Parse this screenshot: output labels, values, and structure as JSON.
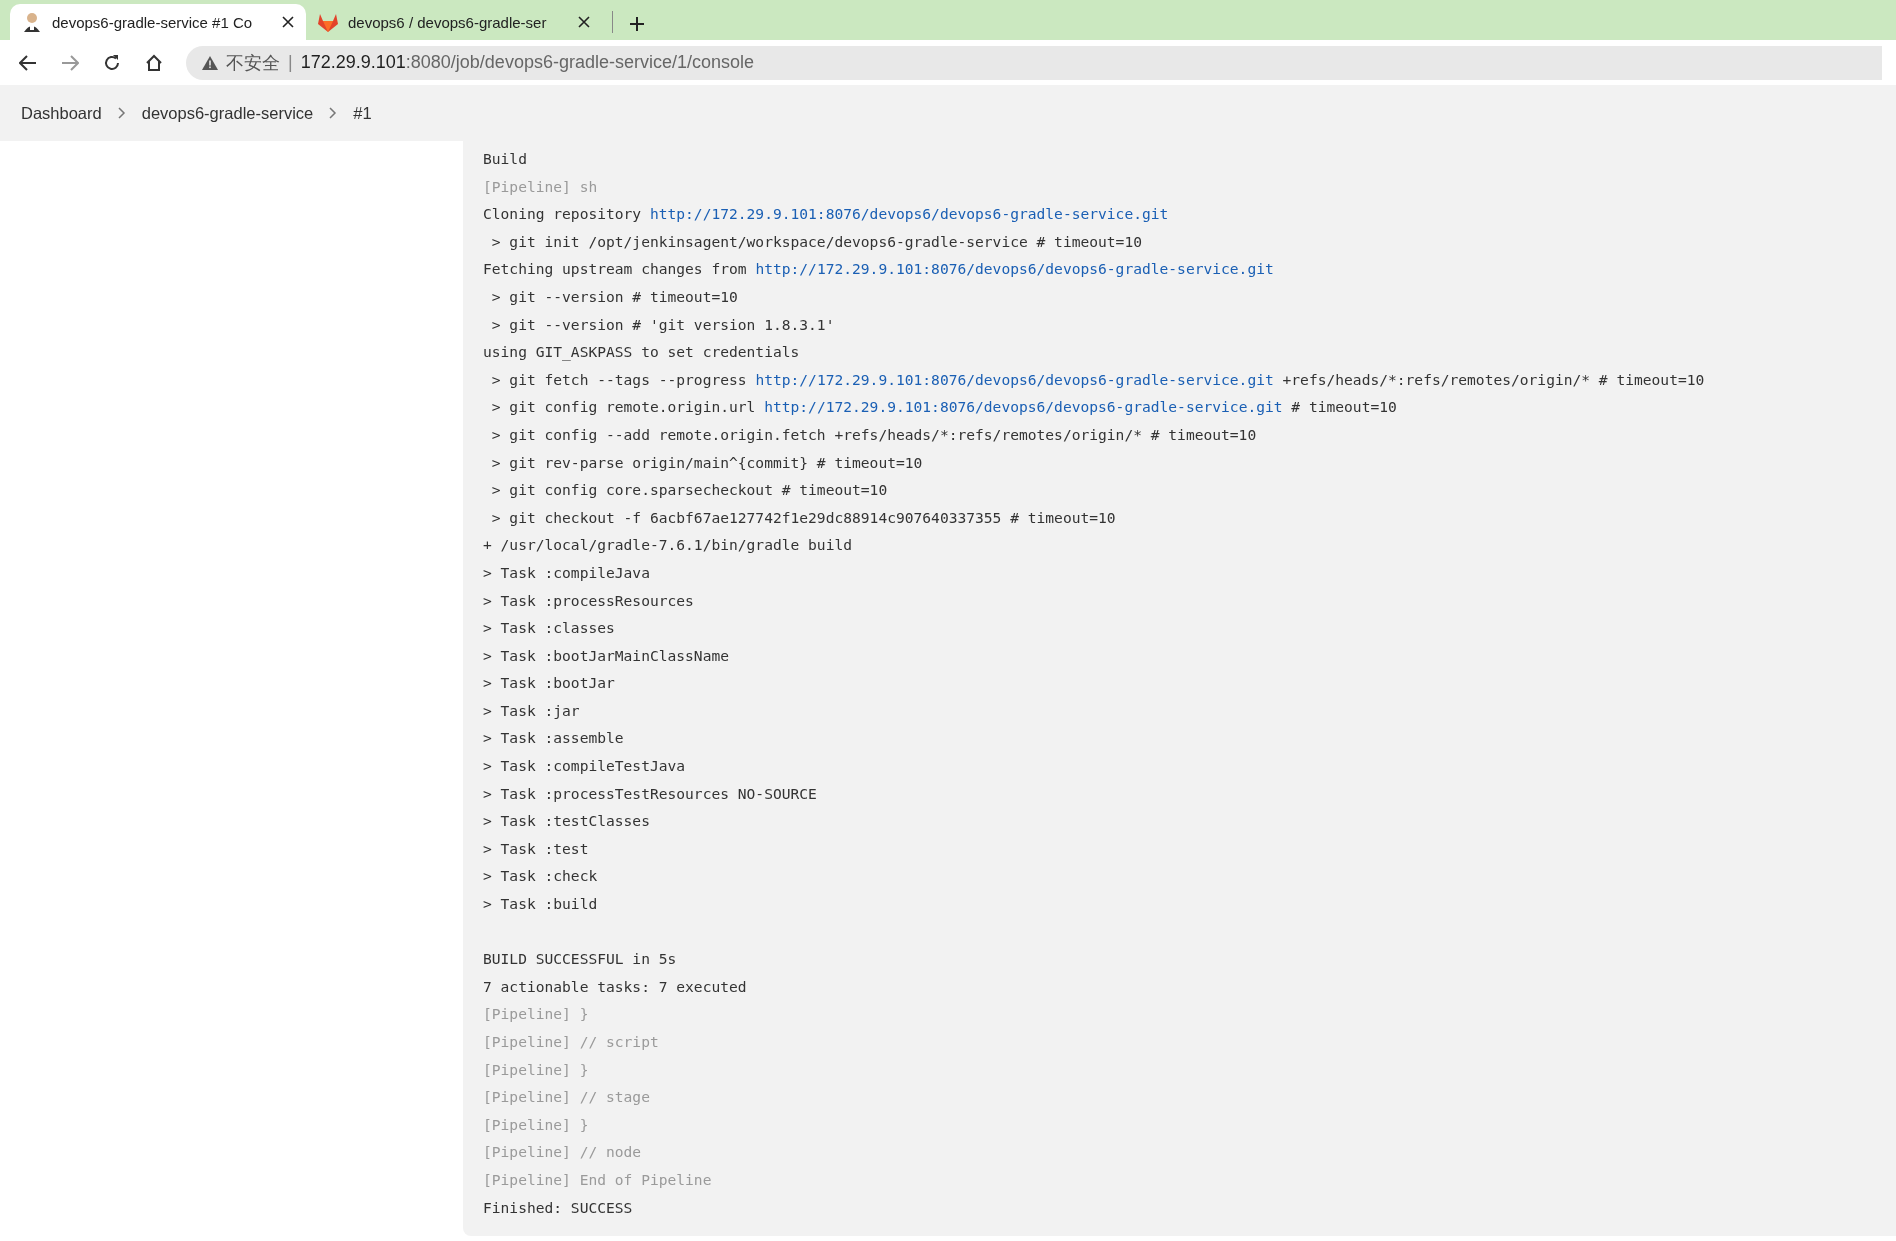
{
  "tabs": [
    {
      "title": "devops6-gradle-service #1 Co",
      "selected": true
    },
    {
      "title": "devops6 / devops6-gradle-ser",
      "selected": false
    }
  ],
  "address_bar": {
    "security_label": "不安全",
    "divider": "|",
    "host": "172.29.9.101",
    "path": ":8080/job/devops6-gradle-service/1/console"
  },
  "breadcrumb": [
    "Dashboard",
    "devops6-gradle-service",
    "#1"
  ],
  "console": [
    {
      "kind": "output",
      "text": "Build"
    },
    {
      "kind": "pipeline",
      "text": "[Pipeline] sh"
    },
    {
      "kind": "link_line",
      "prefix": "Cloning repository ",
      "url": "http://172.29.9.101:8076/devops6/devops6-gradle-service.git"
    },
    {
      "kind": "output",
      "text": " > git init /opt/jenkinsagent/workspace/devops6-gradle-service # timeout=10"
    },
    {
      "kind": "link_line",
      "prefix": "Fetching upstream changes from ",
      "url": "http://172.29.9.101:8076/devops6/devops6-gradle-service.git"
    },
    {
      "kind": "output",
      "text": " > git --version # timeout=10"
    },
    {
      "kind": "output",
      "text": " > git --version # 'git version 1.8.3.1'"
    },
    {
      "kind": "output",
      "text": "using GIT_ASKPASS to set credentials"
    },
    {
      "kind": "link_line",
      "prefix": " > git fetch --tags --progress ",
      "url": "http://172.29.9.101:8076/devops6/devops6-gradle-service.git",
      "suffix": " +refs/heads/*:refs/remotes/origin/* # timeout=10"
    },
    {
      "kind": "link_line",
      "prefix": " > git config remote.origin.url ",
      "url": "http://172.29.9.101:8076/devops6/devops6-gradle-service.git",
      "suffix": " # timeout=10"
    },
    {
      "kind": "output",
      "text": " > git config --add remote.origin.fetch +refs/heads/*:refs/remotes/origin/* # timeout=10"
    },
    {
      "kind": "output",
      "text": " > git rev-parse origin/main^{commit} # timeout=10"
    },
    {
      "kind": "output",
      "text": " > git config core.sparsecheckout # timeout=10"
    },
    {
      "kind": "output",
      "text": " > git checkout -f 6acbf67ae127742f1e29dc88914c907640337355 # timeout=10"
    },
    {
      "kind": "output",
      "text": "+ /usr/local/gradle-7.6.1/bin/gradle build"
    },
    {
      "kind": "output",
      "text": "> Task :compileJava"
    },
    {
      "kind": "output",
      "text": "> Task :processResources"
    },
    {
      "kind": "output",
      "text": "> Task :classes"
    },
    {
      "kind": "output",
      "text": "> Task :bootJarMainClassName"
    },
    {
      "kind": "output",
      "text": "> Task :bootJar"
    },
    {
      "kind": "output",
      "text": "> Task :jar"
    },
    {
      "kind": "output",
      "text": "> Task :assemble"
    },
    {
      "kind": "output",
      "text": "> Task :compileTestJava"
    },
    {
      "kind": "output",
      "text": "> Task :processTestResources NO-SOURCE"
    },
    {
      "kind": "output",
      "text": "> Task :testClasses"
    },
    {
      "kind": "output",
      "text": "> Task :test"
    },
    {
      "kind": "output",
      "text": "> Task :check"
    },
    {
      "kind": "output",
      "text": "> Task :build"
    },
    {
      "kind": "blank"
    },
    {
      "kind": "output",
      "text": "BUILD SUCCESSFUL in 5s"
    },
    {
      "kind": "output",
      "text": "7 actionable tasks: 7 executed"
    },
    {
      "kind": "pipeline",
      "text": "[Pipeline] }"
    },
    {
      "kind": "pipeline",
      "text": "[Pipeline] // script"
    },
    {
      "kind": "pipeline",
      "text": "[Pipeline] }"
    },
    {
      "kind": "pipeline",
      "text": "[Pipeline] // stage"
    },
    {
      "kind": "pipeline",
      "text": "[Pipeline] }"
    },
    {
      "kind": "pipeline",
      "text": "[Pipeline] // node"
    },
    {
      "kind": "pipeline",
      "text": "[Pipeline] End of Pipeline"
    },
    {
      "kind": "output",
      "text": "Finished: SUCCESS"
    }
  ]
}
